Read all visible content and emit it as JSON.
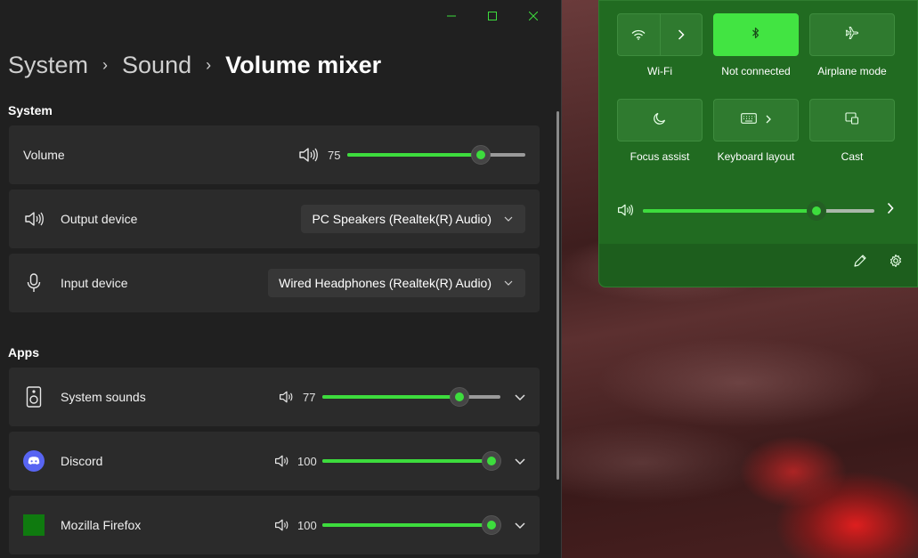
{
  "breadcrumb": {
    "level1": "System",
    "level2": "Sound",
    "current": "Volume mixer"
  },
  "sections": {
    "system": "System",
    "apps": "Apps"
  },
  "system": {
    "volume": {
      "label": "Volume",
      "value": "75",
      "level": 0.75
    },
    "output": {
      "label": "Output device",
      "selected": "PC Speakers (Realtek(R) Audio)"
    },
    "input": {
      "label": "Input device",
      "selected": "Wired Headphones (Realtek(R) Audio)"
    }
  },
  "apps": [
    {
      "name": "System sounds",
      "value": "77",
      "level": 0.77,
      "icon": "speaker-device-icon"
    },
    {
      "name": "Discord",
      "value": "100",
      "level": 1.0,
      "icon": "discord-icon"
    },
    {
      "name": "Mozilla Firefox",
      "value": "100",
      "level": 1.0,
      "icon": "firefox-icon"
    }
  ],
  "quick_settings": {
    "tiles": [
      {
        "label": "Wi-Fi",
        "icon": "wifi-icon",
        "active": false
      },
      {
        "label": "Not connected",
        "icon": "bluetooth-icon",
        "active": true
      },
      {
        "label": "Airplane mode",
        "icon": "airplane-icon",
        "active": false
      },
      {
        "label": "Focus assist",
        "icon": "moon-icon",
        "active": false
      },
      {
        "label": "Keyboard layout",
        "icon": "keyboard-icon",
        "active": false
      },
      {
        "label": "Cast",
        "icon": "cast-icon",
        "active": false
      }
    ],
    "volume_level": 0.75
  },
  "colors": {
    "accent": "#3ddc3d",
    "window_bg": "#202020",
    "card_bg": "#2b2b2b",
    "quick_settings_bg": "#216b21"
  }
}
